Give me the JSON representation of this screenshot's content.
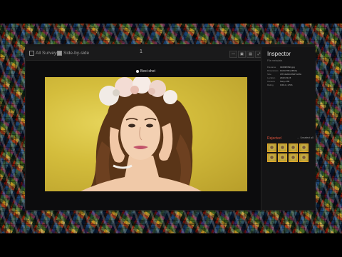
{
  "toolbar": {
    "surveys_label": "All Surveys",
    "side_by_side_label": "Side-by-side",
    "counter": "1",
    "buttons": [
      "—",
      "▣",
      "▤",
      "⤢"
    ]
  },
  "viewer": {
    "badge": "Best shot"
  },
  "inspector": {
    "title": "Inspector",
    "subtitle": "File metadata",
    "metadata": [
      {
        "key": "Filename",
        "value": "01003P2N1.jpg"
      },
      {
        "key": "Dimensions",
        "value": "1024×768 (JPEG)"
      },
      {
        "key": "Size",
        "value": "IPTC/EXIF/XMP DATA"
      },
      {
        "key": "Location",
        "value": "2022-03-15"
      },
      {
        "key": "Camera",
        "value": "Sony A7R"
      },
      {
        "key": "Rating",
        "value": "0.00 ct, 2.5%"
      }
    ],
    "rejected_label": "Rejected",
    "unselect_label": "← Unselect all",
    "thumb_count": 8
  },
  "colors": {
    "accent_orange": "#e2a82a",
    "rejected_red": "#e0533c",
    "window_bg": "#0c0c0d",
    "photo_yellow": "#d4bd3c"
  }
}
